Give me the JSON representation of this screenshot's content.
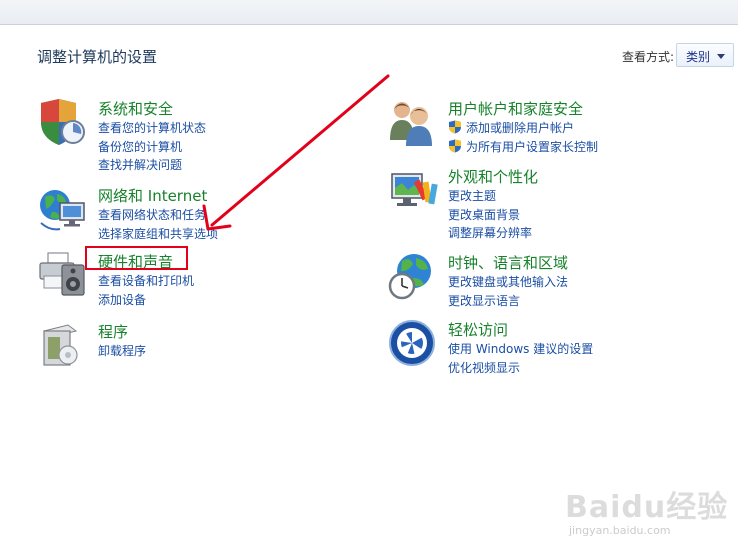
{
  "header": {
    "page_title": "调整计算机的设置",
    "view_by_label": "查看方式:",
    "view_by_value": "类别"
  },
  "categories": [
    {
      "title": "系统和安全",
      "links": [
        "查看您的计算机状态",
        "备份您的计算机",
        "查找并解决问题"
      ]
    },
    {
      "title": "网络和 Internet",
      "links": [
        "查看网络状态和任务",
        "选择家庭组和共享选项"
      ]
    },
    {
      "title": "硬件和声音",
      "links": [
        "查看设备和打印机",
        "添加设备"
      ]
    },
    {
      "title": "程序",
      "links": [
        "卸载程序"
      ]
    },
    {
      "title": "用户帐户和家庭安全",
      "links": [
        "添加或删除用户帐户",
        "为所有用户设置家长控制"
      ]
    },
    {
      "title": "外观和个性化",
      "links": [
        "更改主题",
        "更改桌面背景",
        "调整屏幕分辨率"
      ]
    },
    {
      "title": "时钟、语言和区域",
      "links": [
        "更改键盘或其他输入法",
        "更改显示语言"
      ]
    },
    {
      "title": "轻松访问",
      "links": [
        "使用 Windows 建议的设置",
        "优化视频显示"
      ]
    }
  ],
  "annotation": {
    "color": "#e2001a",
    "highlighted_item": "硬件和声音"
  },
  "watermark": {
    "logo": "Baidu经验",
    "url": "jingyan.baidu.com"
  },
  "colors": {
    "category_title": "#17822b",
    "link": "#1b4ea3",
    "page_title": "#1e395b"
  }
}
